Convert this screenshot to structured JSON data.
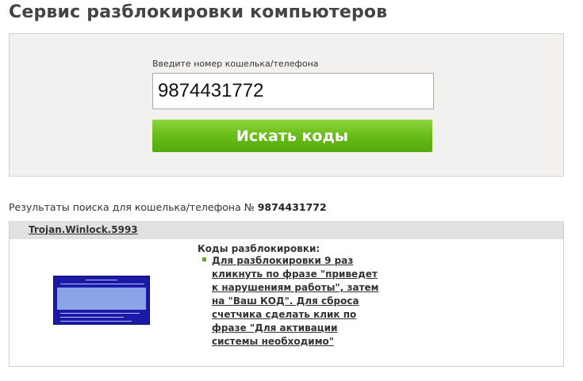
{
  "header": {
    "title": "Сервис разблокировки компьютеров"
  },
  "search": {
    "label": "Введите номер кошелька/телефона",
    "value": "9874431772",
    "button_label": "Искать коды"
  },
  "results": {
    "prefix": "Результаты поиска для кошелька/телефона №",
    "number": "9874431772",
    "item": {
      "virus_name": "Trojan.Winlock.5993",
      "codes_title": "Коды разблокировки:",
      "code_text": "Для разблокировки 9 раз кликнуть по фразе \"приведет к нарушениям работы\", затем на \"Ваш КОД\". Для сброса счетчика сделать клик по фразе \"Для активации системы необходимо\""
    }
  },
  "colors": {
    "accent_green": "#6cbf1a",
    "panel_bg": "#f2f1ef",
    "result_bar": "#e1e1e1",
    "thumb_blue": "#1a1aa6"
  }
}
